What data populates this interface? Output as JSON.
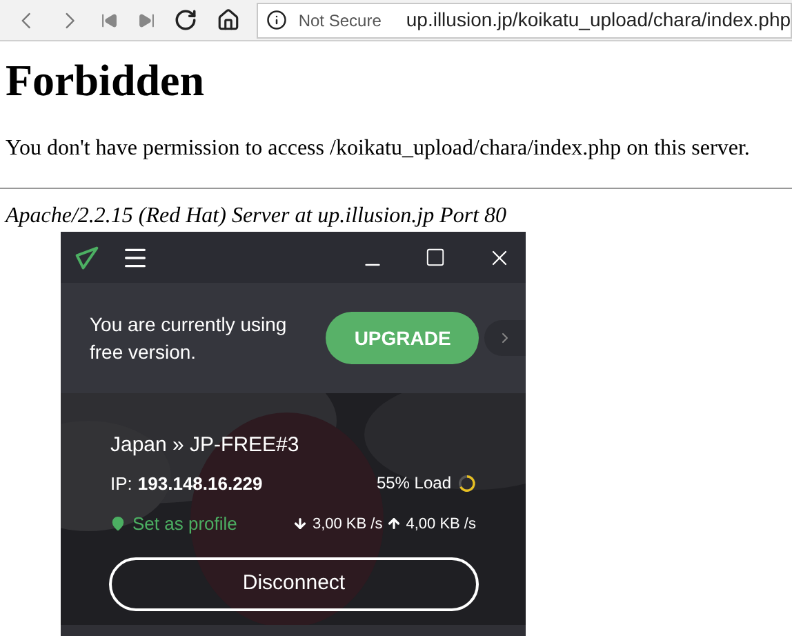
{
  "browser": {
    "security_label": "Not Secure",
    "url": "up.illusion.jp/koikatu_upload/chara/index.php"
  },
  "page": {
    "heading": "Forbidden",
    "message": "You don't have permission to access /koikatu_upload/chara/index.php on this server.",
    "address": "Apache/2.2.15 (Red Hat) Server at up.illusion.jp Port 80"
  },
  "vpn": {
    "banner": "You are currently using free version.",
    "upgrade": "UPGRADE",
    "server": "Japan » JP-FREE#3",
    "ip_label": "IP:",
    "ip": "193.148.16.229",
    "load": "55% Load",
    "set_profile": "Set as profile",
    "download": "3,00 KB /s",
    "upload": "4,00 KB /s",
    "disconnect": "Disconnect"
  }
}
